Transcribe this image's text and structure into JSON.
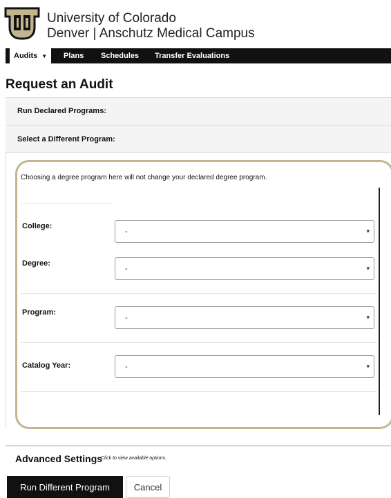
{
  "header": {
    "logo_icon": "cu-logo-icon",
    "logo_color": "#c4b490",
    "university_line1": "University of Colorado",
    "university_line2": "Denver | Anschutz Medical Campus"
  },
  "nav": {
    "items": [
      {
        "label": "Audits",
        "active": true,
        "dropdown": true
      },
      {
        "label": "Plans"
      },
      {
        "label": "Schedules"
      },
      {
        "label": "Transfer Evaluations"
      }
    ],
    "dropdown_icon": "caret-down-icon"
  },
  "page": {
    "title": "Request an Audit"
  },
  "panels": {
    "declared": "Run Declared Programs:",
    "different": "Select a Different Program:"
  },
  "form": {
    "notice": "Choosing a degree program here will not change your declared degree program.",
    "fields": [
      {
        "label": "College:",
        "value": "-"
      },
      {
        "label": "Degree:",
        "value": "-"
      },
      {
        "label": "Program:",
        "value": "-"
      },
      {
        "label": "Catalog Year:",
        "value": "-"
      }
    ],
    "select_arrow": "▾"
  },
  "advanced": {
    "title": "Advanced Settings",
    "hint": "Click to view available options."
  },
  "buttons": {
    "run": "Run Different Program",
    "cancel": "Cancel"
  },
  "colors": {
    "accent_gold": "#c4b490",
    "nav_bg": "#111111"
  }
}
